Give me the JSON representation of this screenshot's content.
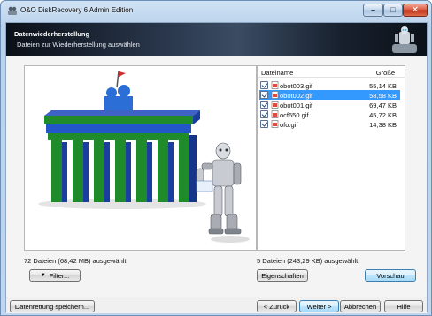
{
  "window": {
    "title": "O&O DiskRecovery 6 Admin Edition",
    "icons": {
      "app": "oo-app-icon",
      "minimize": "minimize-icon",
      "maximize": "maximize-icon",
      "close": "close-icon"
    }
  },
  "header": {
    "title": "Datenwiederherstellung",
    "subtitle": "Dateien zur Wiederherstellung auswählen"
  },
  "preview": {
    "status": "72 Dateien (68,42 MB) ausgewählt",
    "filter_button": "Filter..."
  },
  "file_list": {
    "columns": {
      "name": "Dateiname",
      "size": "Größe"
    },
    "rows": [
      {
        "name": "obot003.gif",
        "size": "55,14 KB",
        "checked": true,
        "selected": false
      },
      {
        "name": "obot002.gif",
        "size": "58,58 KB",
        "checked": true,
        "selected": true
      },
      {
        "name": "obot001.gif",
        "size": "69,47 KB",
        "checked": true,
        "selected": false
      },
      {
        "name": "ocf650.gif",
        "size": "45,72 KB",
        "checked": true,
        "selected": false
      },
      {
        "name": "ofo.gif",
        "size": "14,38 KB",
        "checked": true,
        "selected": false
      }
    ],
    "status": "5 Dateien (243,29 KB) ausgewählt",
    "properties_button": "Eigenschaften",
    "preview_button": "Vorschau"
  },
  "footer": {
    "save_button": "Datenrettung speichern...",
    "back_button": "< Zurück",
    "next_button": "Weiter >",
    "cancel_button": "Abbrechen",
    "help_button": "Hilfe"
  },
  "colors": {
    "selection": "#3399ff",
    "gate_green": "#1e8a2a",
    "gate_blue": "#1f3fa8"
  }
}
